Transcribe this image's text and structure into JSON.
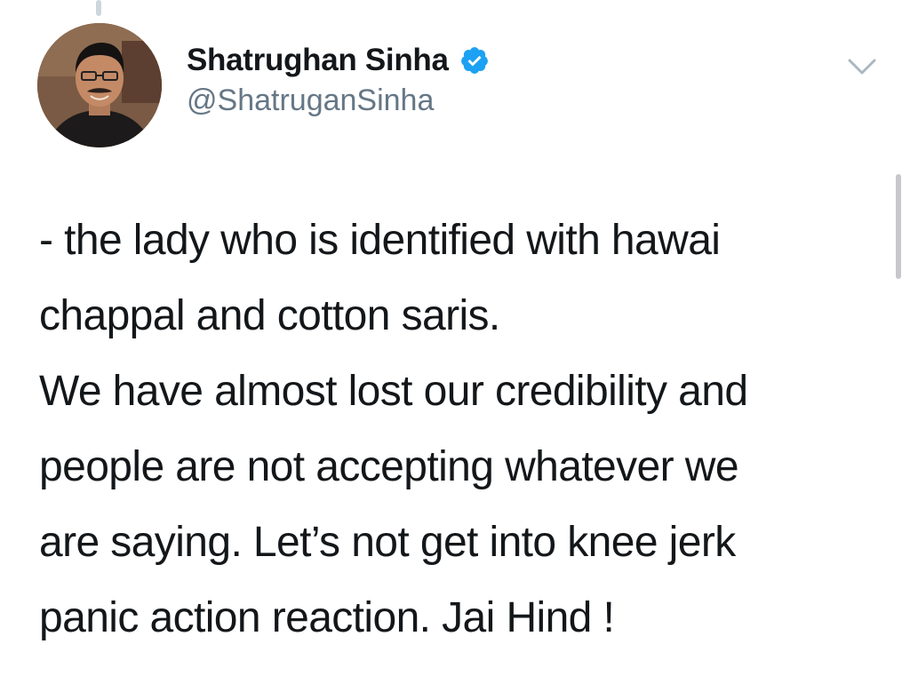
{
  "tweet": {
    "author": {
      "display_name": "Shatrughan Sinha",
      "handle": "@ShatruganSinha",
      "verified": true,
      "verified_color": "#1da1f2"
    },
    "body_lines": [
      "- the lady who is identified with hawai",
      "chappal and cotton saris.",
      "We have almost lost our credibility and",
      "people are not accepting whatever we",
      "are saying. Let’s not get into knee jerk",
      "panic action reaction. Jai Hind !"
    ],
    "menu_icon": "chevron-down-icon"
  },
  "colors": {
    "text": "#14171a",
    "secondary_text": "#657786",
    "verified": "#1da1f2"
  }
}
